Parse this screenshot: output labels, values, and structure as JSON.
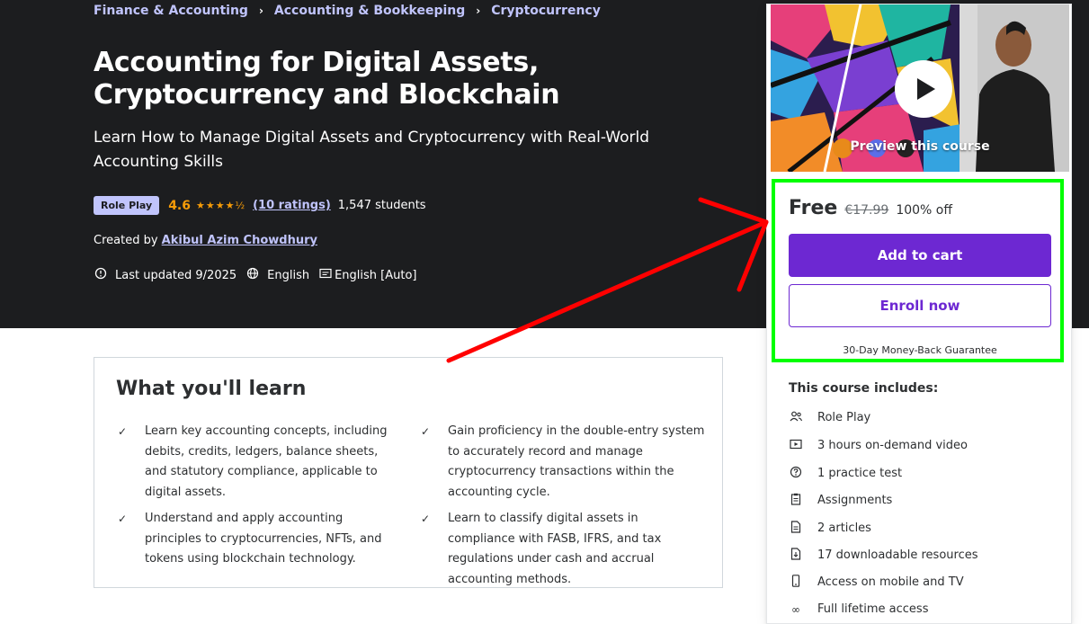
{
  "breadcrumb": [
    "Finance & Accounting",
    "Accounting & Bookkeeping",
    "Cryptocurrency"
  ],
  "course": {
    "title": "Accounting for Digital Assets, Cryptocurrency and Blockchain",
    "subtitle": "Learn How to Manage Digital Assets and Cryptocurrency with Real-World Accounting Skills",
    "badge": "Role Play",
    "rating": "4.6",
    "rating_count": "(10 ratings)",
    "students": "1,547 students",
    "created_by_label": "Created by",
    "author": "Akibul Azim Chowdhury",
    "last_updated": "Last updated 9/2025",
    "language": "English",
    "captions": "English [Auto]"
  },
  "learn": {
    "title": "What you'll learn",
    "items": [
      "Learn key accounting concepts, including debits, credits, ledgers, balance sheets, and statutory compliance, applicable to digital assets.",
      "Gain proficiency in the double-entry system to accurately record and manage cryptocurrency transactions within the accounting cycle.",
      "Understand and apply accounting principles to cryptocurrencies, NFTs, and tokens using blockchain technology.",
      "Learn to classify digital assets in compliance with FASB, IFRS, and tax regulations under cash and accrual accounting methods."
    ]
  },
  "sidebar": {
    "preview_label": "Preview this course",
    "price": "Free",
    "original_price": "€17.99",
    "discount": "100% off",
    "add_to_cart": "Add to cart",
    "enroll_now": "Enroll now",
    "guarantee": "30-Day Money-Back Guarantee",
    "includes_title": "This course includes:",
    "includes": [
      {
        "icon": "role-play-icon",
        "label": "Role Play"
      },
      {
        "icon": "video-icon",
        "label": "3 hours on-demand video"
      },
      {
        "icon": "question-icon",
        "label": "1 practice test"
      },
      {
        "icon": "assignment-icon",
        "label": "Assignments"
      },
      {
        "icon": "article-icon",
        "label": "2 articles"
      },
      {
        "icon": "download-icon",
        "label": "17 downloadable resources"
      },
      {
        "icon": "mobile-icon",
        "label": "Access on mobile and TV"
      },
      {
        "icon": "infinity-icon",
        "label": "Full lifetime access"
      }
    ]
  },
  "colors": {
    "hero_bg": "#1c1d1f",
    "accent_purple": "#6d28d2",
    "link_lavender": "#c0c4fc",
    "star_orange": "#f69c08",
    "highlight_green": "#00ff00",
    "arrow_red": "#ff0000"
  }
}
